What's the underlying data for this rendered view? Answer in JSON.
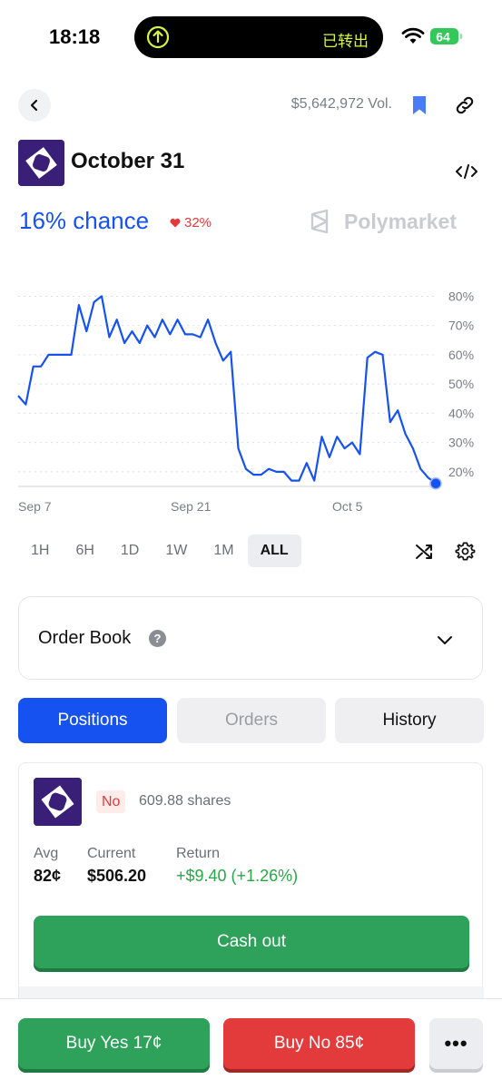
{
  "status_bar": {
    "time": "18:18",
    "island_text": "已转出",
    "battery": "64",
    "accent": "#d4f542"
  },
  "header": {
    "volume": "$5,642,972 Vol.",
    "title": "October 31",
    "chance": "16% chance",
    "change": "32%",
    "brand": "Polymarket",
    "icons": [
      "back-icon",
      "bookmark-icon",
      "link-icon",
      "embed-code-icon"
    ]
  },
  "chart_data": {
    "type": "line",
    "x_ticks": [
      "Sep 7",
      "Sep 21",
      "Oct 5"
    ],
    "y_ticks": [
      "80%",
      "70%",
      "60%",
      "50%",
      "40%",
      "30%",
      "20%"
    ],
    "ylim": [
      15,
      82
    ],
    "color": "#1552f0",
    "grid": "dotted-horizontal",
    "series": [
      {
        "values": [
          46,
          43,
          56,
          56,
          60,
          60,
          60,
          60,
          77,
          68,
          78,
          80,
          66,
          72,
          64,
          68,
          64,
          70,
          66,
          72,
          67,
          72,
          67,
          67,
          66,
          72,
          64,
          58,
          61,
          28,
          21,
          19,
          19,
          21,
          20,
          20,
          17,
          17,
          23,
          17,
          32,
          25,
          32,
          28,
          30,
          26,
          59,
          61,
          60,
          37,
          41,
          33,
          28,
          21,
          18,
          16
        ]
      }
    ]
  },
  "timeframes": {
    "options": [
      "1H",
      "6H",
      "1D",
      "1W",
      "1M",
      "ALL"
    ],
    "active": "ALL"
  },
  "order_book": {
    "title": "Order Book",
    "help": "?"
  },
  "tabs": {
    "positions": "Positions",
    "orders": "Orders",
    "history": "History"
  },
  "position": {
    "side": "No",
    "shares": "609.88 shares",
    "avg_label": "Avg",
    "avg_value": "82¢",
    "current_label": "Current",
    "current_value": "$506.20",
    "return_label": "Return",
    "return_value": "+$9.40 (+1.26%)",
    "cashout_label": "Cash out"
  },
  "bottom_bar": {
    "buy_yes": "Buy Yes 17¢",
    "buy_no": "Buy No 85¢",
    "more": "•••"
  }
}
